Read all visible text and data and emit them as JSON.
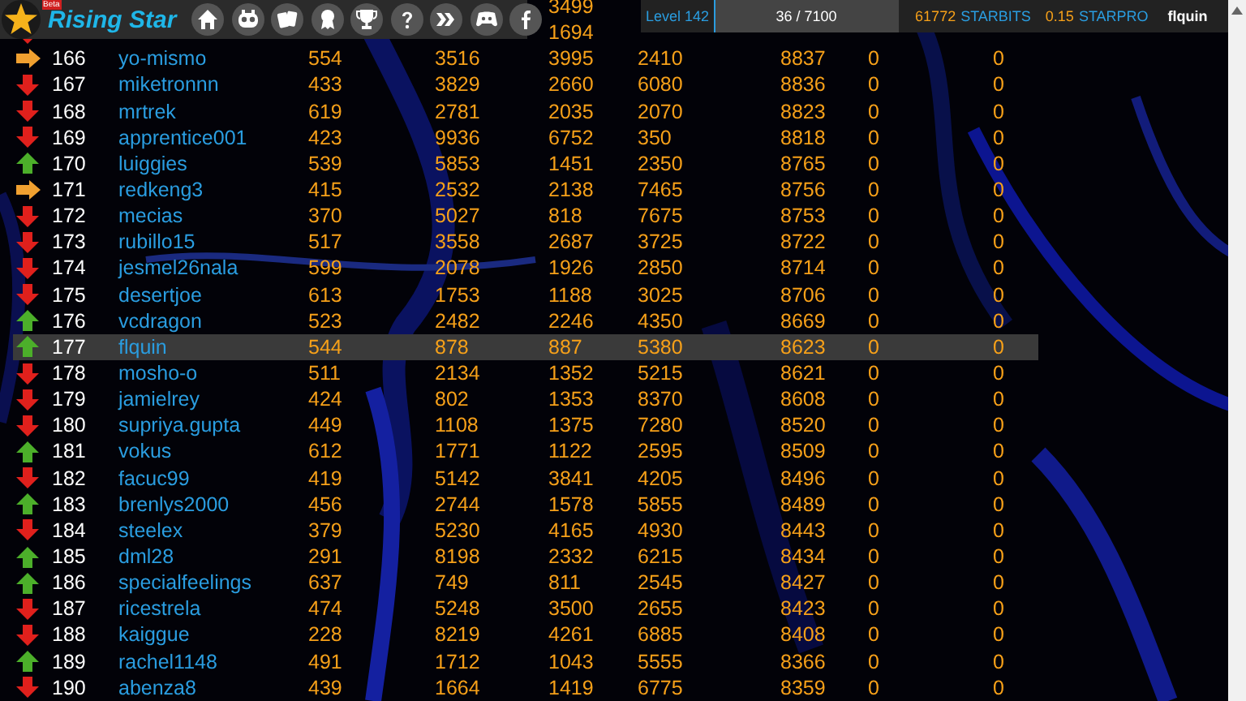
{
  "header": {
    "badge": "Beta",
    "title": "Rising Star"
  },
  "stats_bar": {
    "level_label": "Level 142",
    "progress": {
      "text": "36 / 7100",
      "level": 0.005
    },
    "starbits": {
      "value": "61772",
      "label": "STARBITS"
    },
    "starpro": {
      "value": "0.15",
      "label": "STARPRO"
    },
    "username": "flquin"
  },
  "rows": [
    {
      "col5": "3499",
      "selected": false
    },
    {
      "kind": "down",
      "col5": "1694",
      "selected": false
    },
    {
      "kind": "same",
      "rank": "166",
      "name": "yo-mismo",
      "col3": "554",
      "col4": "3516",
      "col5": "3995",
      "col6": "2410",
      "col7": "8837",
      "col8": "0",
      "col9": "0",
      "selected": false
    },
    {
      "kind": "down",
      "rank": "167",
      "name": "miketronnn",
      "col3": "433",
      "col4": "3829",
      "col5": "2660",
      "col6": "6080",
      "col7": "8836",
      "col8": "0",
      "col9": "0",
      "selected": false
    },
    {
      "kind": "down",
      "rank": "168",
      "name": "mrtrek",
      "col3": "619",
      "col4": "2781",
      "col5": "2035",
      "col6": "2070",
      "col7": "8823",
      "col8": "0",
      "col9": "0",
      "selected": false
    },
    {
      "kind": "down",
      "rank": "169",
      "name": "apprentice001",
      "col3": "423",
      "col4": "9936",
      "col5": "6752",
      "col6": "350",
      "col7": "8818",
      "col8": "0",
      "col9": "0",
      "selected": false
    },
    {
      "kind": "up",
      "rank": "170",
      "name": "luiggies",
      "col3": "539",
      "col4": "5853",
      "col5": "1451",
      "col6": "2350",
      "col7": "8765",
      "col8": "0",
      "col9": "0",
      "selected": false
    },
    {
      "kind": "same",
      "rank": "171",
      "name": "redkeng3",
      "col3": "415",
      "col4": "2532",
      "col5": "2138",
      "col6": "7465",
      "col7": "8756",
      "col8": "0",
      "col9": "0",
      "selected": false
    },
    {
      "kind": "down",
      "rank": "172",
      "name": "mecias",
      "col3": "370",
      "col4": "5027",
      "col5": "818",
      "col6": "7675",
      "col7": "8753",
      "col8": "0",
      "col9": "0",
      "selected": false
    },
    {
      "kind": "down",
      "rank": "173",
      "name": "rubillo15",
      "col3": "517",
      "col4": "3558",
      "col5": "2687",
      "col6": "3725",
      "col7": "8722",
      "col8": "0",
      "col9": "0",
      "selected": false
    },
    {
      "kind": "down",
      "rank": "174",
      "name": "jesmel26nala",
      "col3": "599",
      "col4": "2078",
      "col5": "1926",
      "col6": "2850",
      "col7": "8714",
      "col8": "0",
      "col9": "0",
      "selected": false
    },
    {
      "kind": "down",
      "rank": "175",
      "name": "desertjoe",
      "col3": "613",
      "col4": "1753",
      "col5": "1188",
      "col6": "3025",
      "col7": "8706",
      "col8": "0",
      "col9": "0",
      "selected": false
    },
    {
      "kind": "up",
      "rank": "176",
      "name": "vcdragon",
      "col3": "523",
      "col4": "2482",
      "col5": "2246",
      "col6": "4350",
      "col7": "8669",
      "col8": "0",
      "col9": "0",
      "selected": false
    },
    {
      "kind": "up",
      "rank": "177",
      "name": "flquin",
      "col3": "544",
      "col4": "878",
      "col5": "887",
      "col6": "5380",
      "col7": "8623",
      "col8": "0",
      "col9": "0",
      "selected": true
    },
    {
      "kind": "down",
      "rank": "178",
      "name": "mosho-o",
      "col3": "511",
      "col4": "2134",
      "col5": "1352",
      "col6": "5215",
      "col7": "8621",
      "col8": "0",
      "col9": "0",
      "selected": false
    },
    {
      "kind": "down",
      "rank": "179",
      "name": "jamielrey",
      "col3": "424",
      "col4": "802",
      "col5": "1353",
      "col6": "8370",
      "col7": "8608",
      "col8": "0",
      "col9": "0",
      "selected": false
    },
    {
      "kind": "down",
      "rank": "180",
      "name": "supriya.gupta",
      "col3": "449",
      "col4": "1108",
      "col5": "1375",
      "col6": "7280",
      "col7": "8520",
      "col8": "0",
      "col9": "0",
      "selected": false
    },
    {
      "kind": "up",
      "rank": "181",
      "name": "vokus",
      "col3": "612",
      "col4": "1771",
      "col5": "1122",
      "col6": "2595",
      "col7": "8509",
      "col8": "0",
      "col9": "0",
      "selected": false
    },
    {
      "kind": "down",
      "rank": "182",
      "name": "facuc99",
      "col3": "419",
      "col4": "5142",
      "col5": "3841",
      "col6": "4205",
      "col7": "8496",
      "col8": "0",
      "col9": "0",
      "selected": false
    },
    {
      "kind": "up",
      "rank": "183",
      "name": "brenlys2000",
      "col3": "456",
      "col4": "2744",
      "col5": "1578",
      "col6": "5855",
      "col7": "8489",
      "col8": "0",
      "col9": "0",
      "selected": false
    },
    {
      "kind": "down",
      "rank": "184",
      "name": "steelex",
      "col3": "379",
      "col4": "5230",
      "col5": "4165",
      "col6": "4930",
      "col7": "8443",
      "col8": "0",
      "col9": "0",
      "selected": false
    },
    {
      "kind": "up",
      "rank": "185",
      "name": "dml28",
      "col3": "291",
      "col4": "8198",
      "col5": "2332",
      "col6": "6215",
      "col7": "8434",
      "col8": "0",
      "col9": "0",
      "selected": false
    },
    {
      "kind": "up",
      "rank": "186",
      "name": "specialfeelings",
      "col3": "637",
      "col4": "749",
      "col5": "811",
      "col6": "2545",
      "col7": "8427",
      "col8": "0",
      "col9": "0",
      "selected": false
    },
    {
      "kind": "down",
      "rank": "187",
      "name": "ricestrela",
      "col3": "474",
      "col4": "5248",
      "col5": "3500",
      "col6": "2655",
      "col7": "8423",
      "col8": "0",
      "col9": "0",
      "selected": false
    },
    {
      "kind": "down",
      "rank": "188",
      "name": "kaiggue",
      "col3": "228",
      "col4": "8219",
      "col5": "4261",
      "col6": "6885",
      "col7": "8408",
      "col8": "0",
      "col9": "0",
      "selected": false
    },
    {
      "kind": "up",
      "rank": "189",
      "name": "rachel1148",
      "col3": "491",
      "col4": "1712",
      "col5": "1043",
      "col6": "5555",
      "col7": "8366",
      "col8": "0",
      "col9": "0",
      "selected": false
    },
    {
      "kind": "down",
      "rank": "190",
      "name": "abenza8",
      "col3": "439",
      "col4": "1664",
      "col5": "1419",
      "col6": "6775",
      "col7": "8359",
      "col8": "0",
      "col9": "0",
      "selected": false
    }
  ]
}
